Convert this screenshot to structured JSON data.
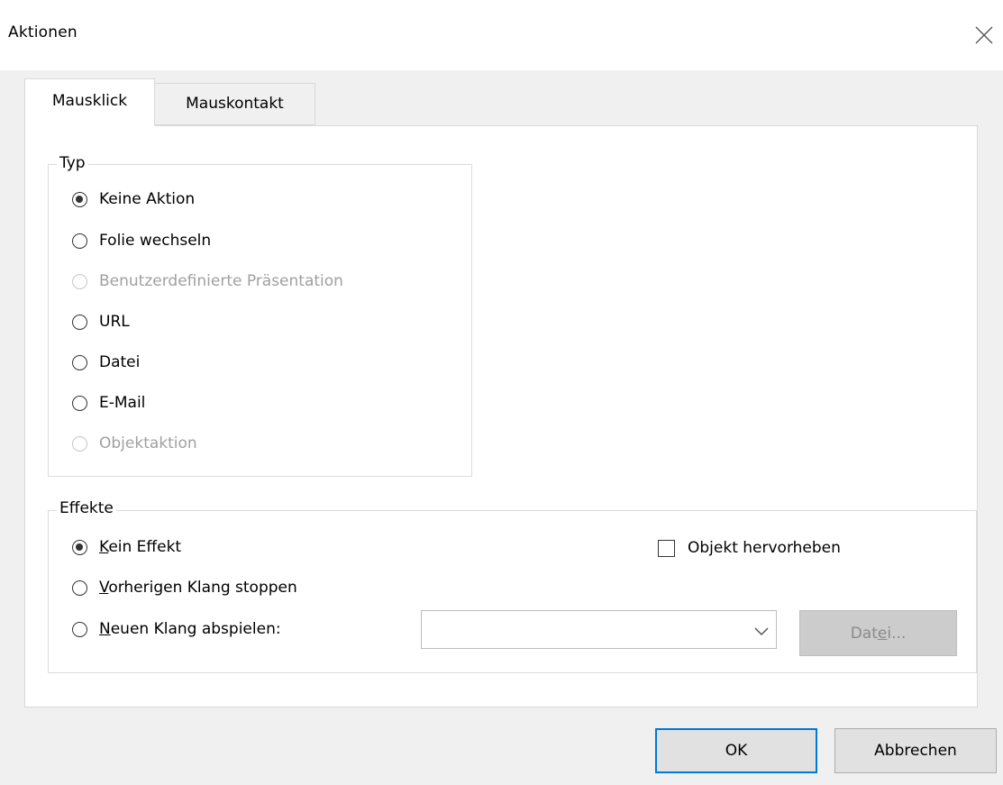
{
  "window": {
    "title": "Aktionen",
    "close_icon": "close-icon"
  },
  "tabs": [
    {
      "label": "Mausklick",
      "active": true
    },
    {
      "label": "Mauskontakt",
      "active": false
    }
  ],
  "typ": {
    "legend": "Typ",
    "options": [
      {
        "label": "Keine Aktion",
        "checked": true,
        "disabled": false
      },
      {
        "label": "Folie wechseln",
        "checked": false,
        "disabled": false
      },
      {
        "label": "Benutzerdefinierte Präsentation",
        "checked": false,
        "disabled": true
      },
      {
        "label": "URL",
        "checked": false,
        "disabled": false
      },
      {
        "label": "Datei",
        "checked": false,
        "disabled": false
      },
      {
        "label": "E-Mail",
        "checked": false,
        "disabled": false
      },
      {
        "label": "Objektaktion",
        "checked": false,
        "disabled": true
      }
    ]
  },
  "effekte": {
    "legend": "Effekte",
    "options": [
      {
        "mnemonic": "K",
        "rest": "ein Effekt",
        "checked": true
      },
      {
        "mnemonic": "V",
        "rest": "orherigen Klang stoppen",
        "checked": false
      },
      {
        "mnemonic": "N",
        "rest": "euen Klang abspielen:",
        "checked": false
      }
    ],
    "highlight_checkbox": {
      "label": "Objekt hervorheben",
      "checked": false
    },
    "sound_select": {
      "value": ""
    },
    "file_button": {
      "pre": "Dat",
      "mnemonic": "e",
      "post": "i...",
      "disabled": true
    }
  },
  "buttons": {
    "ok": "OK",
    "cancel": "Abbrechen"
  }
}
